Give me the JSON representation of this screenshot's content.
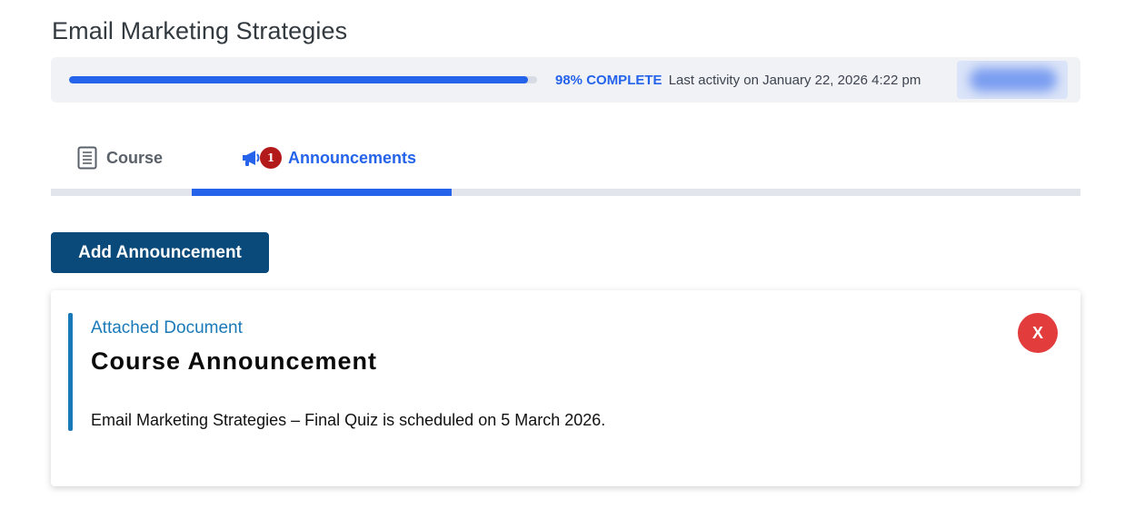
{
  "page": {
    "title": "Email Marketing Strategies"
  },
  "progress": {
    "percent": 98,
    "percent_label": "98% COMPLETE",
    "activity_text": "Last activity on January 22, 2026 4:22 pm",
    "color": "#2563eb"
  },
  "tabs": [
    {
      "label": "Course",
      "icon": "document-icon",
      "active": false
    },
    {
      "label": "Announcements",
      "icon": "megaphone-icon",
      "active": true,
      "badge": "1"
    }
  ],
  "actions": {
    "add_announcement_label": "Add Announcement"
  },
  "announcement": {
    "attached_link": "Attached Document",
    "title": "Course Announcement",
    "body": "Email Marketing Strategies – Final Quiz is scheduled on 5 March 2026.",
    "close_label": "X"
  },
  "colors": {
    "primary": "#2563eb",
    "button": "#0a4a7a",
    "accent": "#1a79b8",
    "danger": "#e23c3c",
    "badge": "#b31b1b"
  }
}
